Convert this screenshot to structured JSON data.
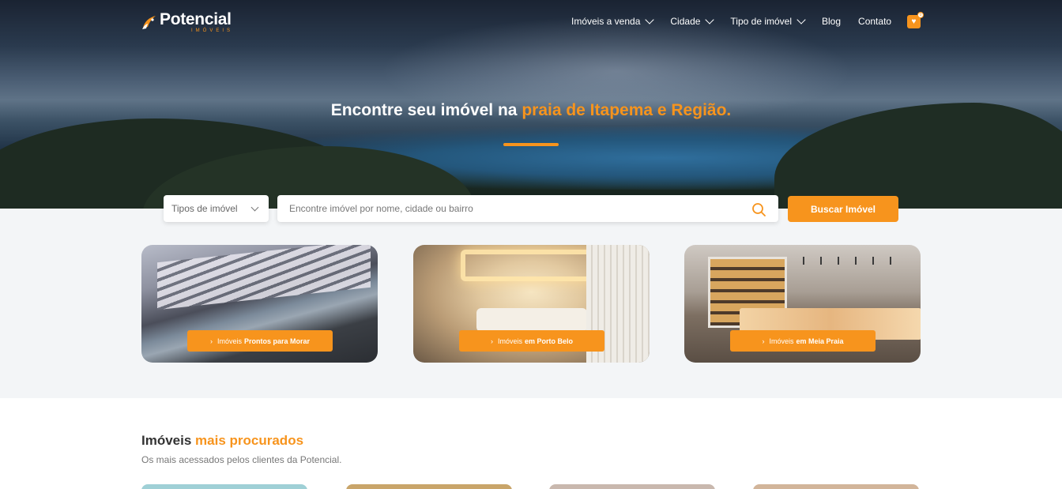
{
  "brand": {
    "name": "Potencial",
    "sub": "IMÓVEIS",
    "accent_color": "#f7941d"
  },
  "nav": {
    "items": [
      {
        "label": "Imóveis a venda",
        "dropdown": true
      },
      {
        "label": "Cidade",
        "dropdown": true
      },
      {
        "label": "Tipo de imóvel",
        "dropdown": true
      },
      {
        "label": "Blog",
        "dropdown": false
      },
      {
        "label": "Contato",
        "dropdown": false
      }
    ],
    "favorites_icon": "heart-icon",
    "favorites_count": "0"
  },
  "hero": {
    "title_prefix": "Encontre seu imóvel na ",
    "title_highlight": "praia de Itapema e Região."
  },
  "search": {
    "type_select": "Tipos de imóvel",
    "placeholder": "Encontre imóvel por nome, cidade ou bairro",
    "button_label": "Buscar Imóvel"
  },
  "cards": [
    {
      "prefix": "Imóveis",
      "highlight": "Prontos para Morar"
    },
    {
      "prefix": "Imóveis",
      "highlight": "em Porto Belo"
    },
    {
      "prefix": "Imóveis",
      "highlight": "em Meia Praia"
    }
  ],
  "most_searched": {
    "title_prefix": "Imóveis ",
    "title_highlight": "mais procurados",
    "subtitle": "Os mais acessados pelos clientes da Potencial."
  }
}
